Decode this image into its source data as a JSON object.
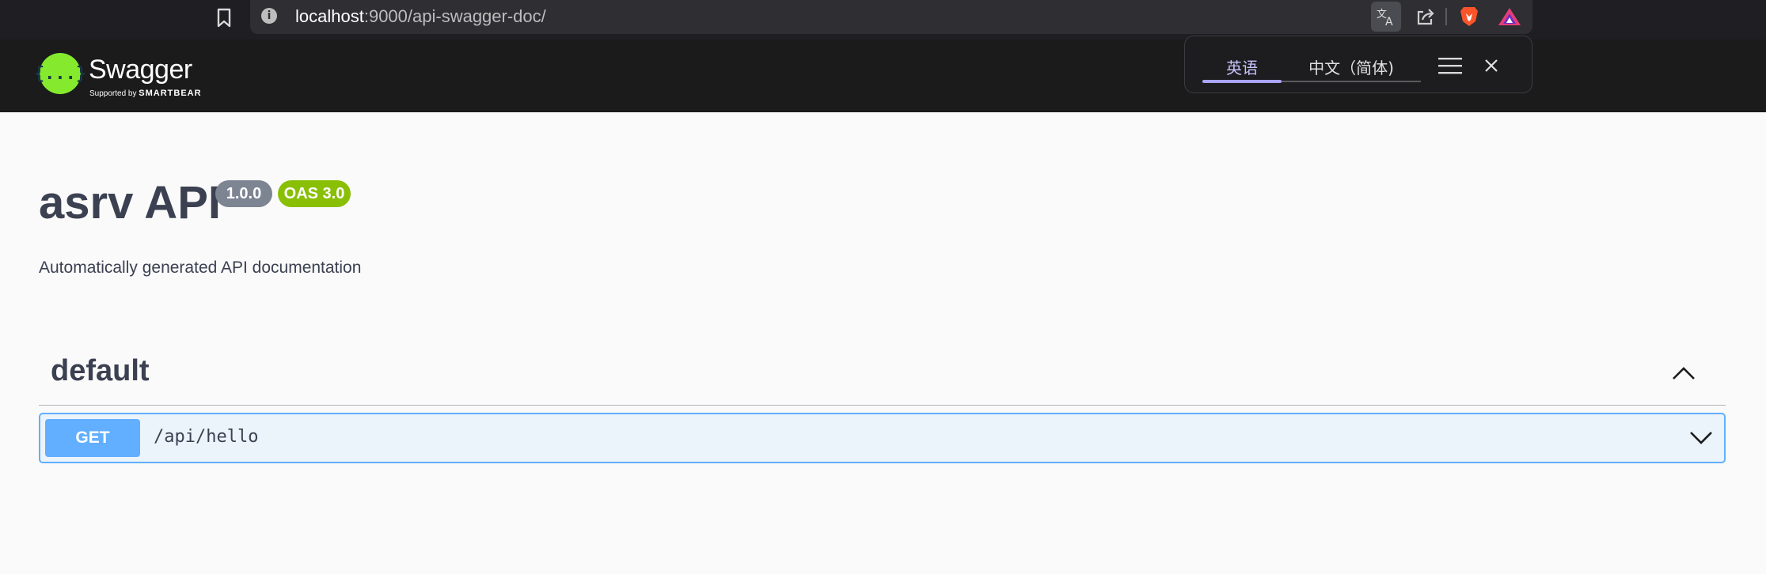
{
  "browser": {
    "url_host": "localhost",
    "url_path": ":9000/api-swagger-doc/"
  },
  "swagger": {
    "logo_symbol": "{...}",
    "logo_word": "Swagger",
    "logo_sub_prefix": "Supported by",
    "logo_sub_brand": "SMARTBEAR"
  },
  "translate_popup": {
    "tab_source": "英语",
    "tab_target": "中文（简体)"
  },
  "info": {
    "title": "asrv API",
    "version": "1.0.0",
    "oas": "OAS 3.0",
    "description": "Automatically generated API documentation"
  },
  "tag": {
    "name": "default",
    "operations": [
      {
        "method": "GET",
        "path": "/api/hello"
      }
    ]
  },
  "colors": {
    "get_method": "#61affe",
    "swagger_green": "#85ea2d",
    "oas_badge": "#89bf04"
  }
}
